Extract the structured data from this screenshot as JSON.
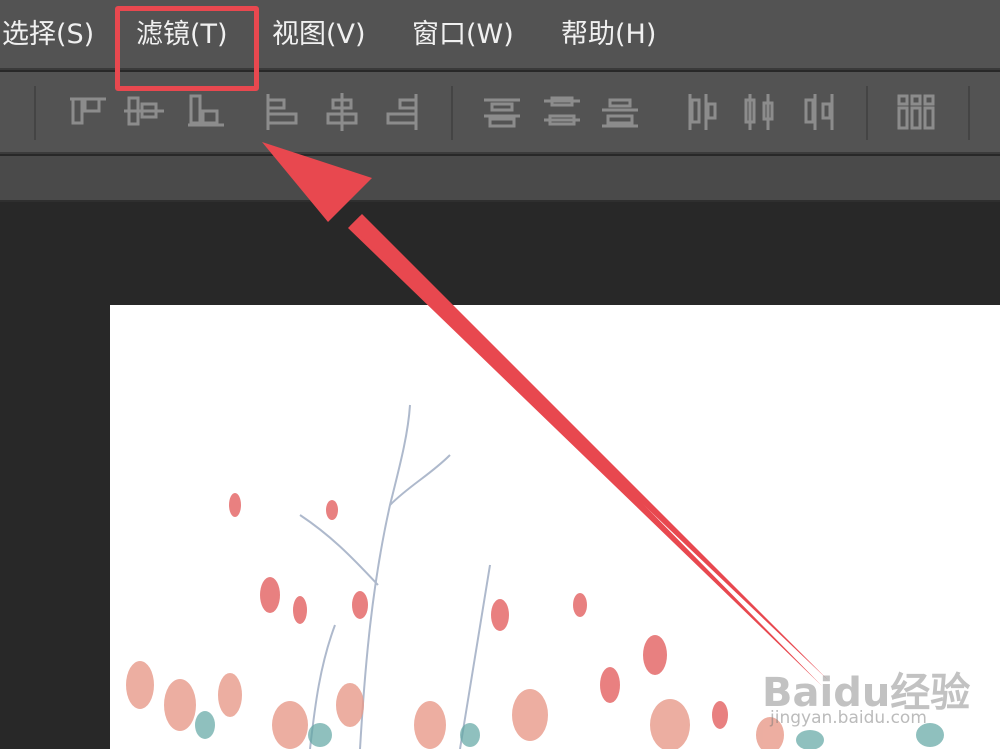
{
  "menubar": {
    "items": [
      {
        "label": "选择(S)"
      },
      {
        "label": "滤镜(T)"
      },
      {
        "label": "视图(V)"
      },
      {
        "label": "窗口(W)"
      },
      {
        "label": "帮助(H)"
      }
    ]
  },
  "highlight": {
    "target": "滤镜(T)",
    "color": "#e8484f"
  },
  "optionsbar": {
    "tools": [
      "align-top-edges-icon",
      "align-vertical-centers-icon",
      "align-bottom-edges-icon",
      "align-left-edges-icon",
      "align-horizontal-centers-icon",
      "align-right-edges-icon",
      "distribute-top-icon",
      "distribute-vertical-centers-icon",
      "distribute-bottom-icon",
      "distribute-left-icon",
      "distribute-horizontal-centers-icon",
      "distribute-right-icon",
      "auto-align-icon"
    ]
  },
  "watermark": {
    "brand": "Baidu经验",
    "url": "jingyan.baidu.com"
  },
  "colors": {
    "menubar": "#535353",
    "workspace": "#282828",
    "arrow": "#e8484f",
    "canvas": "#ffffff"
  }
}
